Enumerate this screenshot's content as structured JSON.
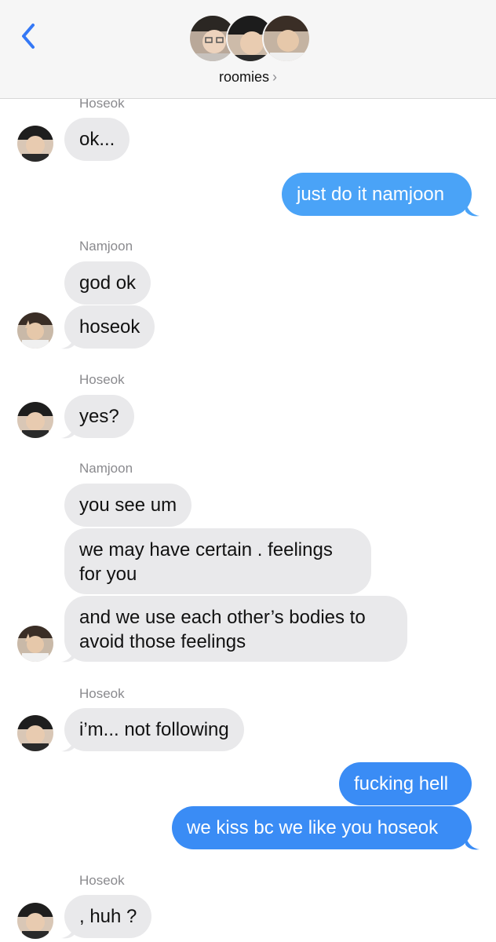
{
  "header": {
    "title": "roomies",
    "chevron": "›",
    "back_icon": "chevron-left-icon",
    "accent": "#3478f6"
  },
  "messages": [
    {
      "sender": "Hoseok",
      "text": "ok..."
    },
    {
      "text": "just do it namjoon"
    },
    {
      "sender": "Namjoon",
      "text": "god ok"
    },
    {
      "text": "hoseok"
    },
    {
      "sender": "Hoseok",
      "text": "yes?"
    },
    {
      "sender": "Namjoon",
      "text": "you see um"
    },
    {
      "text": "we may have certain . feelings\nfor you"
    },
    {
      "text": "and we use each other’s bodies to\navoid those feelings"
    },
    {
      "sender": "Hoseok",
      "text": "i’m... not following"
    },
    {
      "text": "fucking hell"
    },
    {
      "text": "we kiss bc we like you hoseok"
    },
    {
      "sender": "Hoseok",
      "text": ", huh ?"
    }
  ],
  "colors": {
    "incoming_bubble": "#e9e9eb",
    "outgoing_bubble": "#3a8cf5",
    "outgoing_bubble_light": "#4aa3f7"
  }
}
